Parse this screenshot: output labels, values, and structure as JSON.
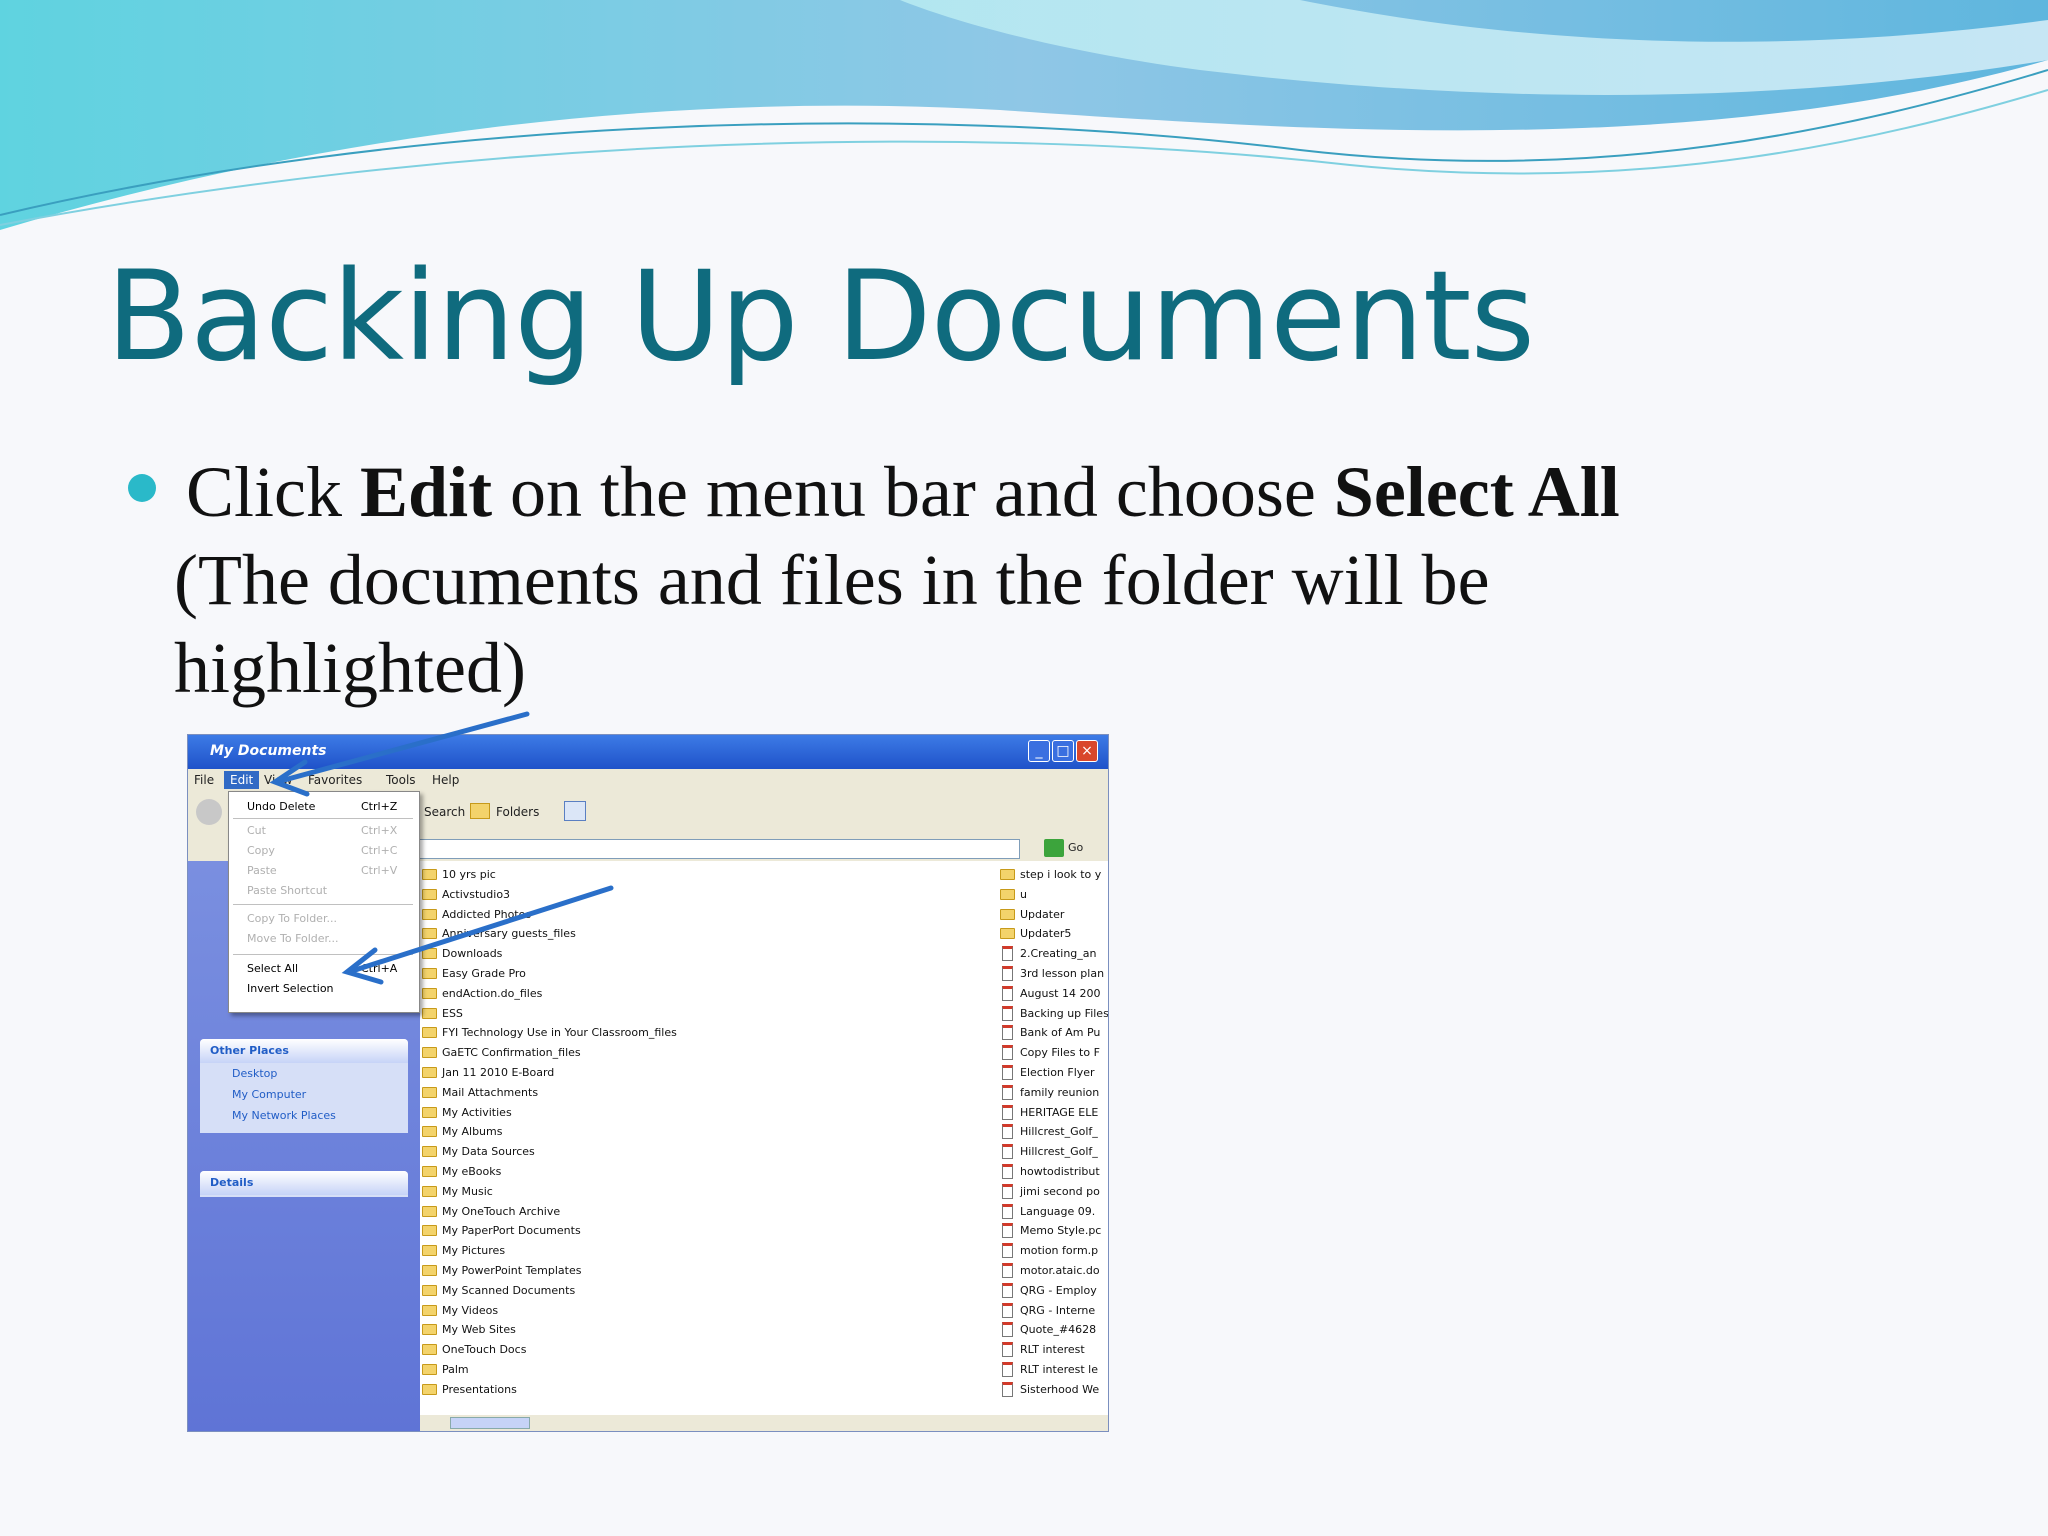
{
  "slide": {
    "title": "Backing Up Documents",
    "bullet": {
      "p1": "Click ",
      "b1": "Edit",
      "p2": " on the menu bar and choose ",
      "b2": "Select All",
      "line2": "(The documents and files in the folder will be",
      "line3": "highlighted)"
    }
  },
  "colors": {
    "title": "#0f6b7e",
    "bullet": "#2ab9c9",
    "arrow": "#2a6fc9"
  },
  "window": {
    "title": "My Documents",
    "menu": [
      "File",
      "Edit",
      "View",
      "Favorites",
      "Tools",
      "Help"
    ],
    "toolbar": {
      "search": "Search",
      "folders": "Folders"
    },
    "go": "Go",
    "edit_menu": [
      {
        "label": "Undo Delete",
        "shortcut": "Ctrl+Z",
        "disabled": false
      },
      {
        "label": "Cut",
        "shortcut": "Ctrl+X",
        "disabled": true
      },
      {
        "label": "Copy",
        "shortcut": "Ctrl+C",
        "disabled": true
      },
      {
        "label": "Paste",
        "shortcut": "Ctrl+V",
        "disabled": true
      },
      {
        "label": "Paste Shortcut",
        "shortcut": "",
        "disabled": true
      },
      {
        "label": "Copy To Folder...",
        "shortcut": "",
        "disabled": true
      },
      {
        "label": "Move To Folder...",
        "shortcut": "",
        "disabled": true
      },
      {
        "label": "Select All",
        "shortcut": "Ctrl+A",
        "disabled": false
      },
      {
        "label": "Invert Selection",
        "shortcut": "",
        "disabled": false
      }
    ],
    "tasks": {
      "other_places": "Other Places",
      "places": [
        "Desktop",
        "My Computer",
        "My Network Places"
      ],
      "details": "Details"
    },
    "files_col1": [
      "10 yrs pic",
      "Activstudio3",
      "Addicted Photos",
      "Anniversary guests_files",
      "Downloads",
      "Easy Grade Pro",
      "endAction.do_files",
      "ESS",
      "FYI Technology Use in Your Classroom_files",
      "GaETC Confirmation_files",
      "Jan 11 2010 E-Board",
      "Mail Attachments",
      "My Activities",
      "My Albums",
      "My Data Sources",
      "My eBooks",
      "My Music",
      "My OneTouch Archive",
      "My PaperPort Documents",
      "My Pictures",
      "My PowerPoint Templates",
      "My Scanned Documents",
      "My Videos",
      "My Web Sites",
      "OneTouch Docs",
      "Palm",
      "Presentations"
    ],
    "files_col2": [
      {
        "name": "step i look to y",
        "kind": "folder"
      },
      {
        "name": "u",
        "kind": "folder"
      },
      {
        "name": "Updater",
        "kind": "folder"
      },
      {
        "name": "Updater5",
        "kind": "folder"
      },
      {
        "name": "2.Creating_an",
        "kind": "doc"
      },
      {
        "name": "3rd lesson plan",
        "kind": "doc"
      },
      {
        "name": "August 14 200",
        "kind": "doc"
      },
      {
        "name": "Backing up Files",
        "kind": "doc"
      },
      {
        "name": "Bank of Am Pu",
        "kind": "doc"
      },
      {
        "name": "Copy Files to F",
        "kind": "doc"
      },
      {
        "name": "Election Flyer",
        "kind": "doc"
      },
      {
        "name": "family reunion",
        "kind": "doc"
      },
      {
        "name": "HERITAGE ELE",
        "kind": "doc"
      },
      {
        "name": "Hillcrest_Golf_",
        "kind": "doc"
      },
      {
        "name": "Hillcrest_Golf_",
        "kind": "doc"
      },
      {
        "name": "howtodistribut",
        "kind": "doc"
      },
      {
        "name": "jimi second po",
        "kind": "doc"
      },
      {
        "name": "Language 09.",
        "kind": "doc"
      },
      {
        "name": "Memo Style.pc",
        "kind": "doc"
      },
      {
        "name": "motion form.p",
        "kind": "doc"
      },
      {
        "name": "motor.ataic.do",
        "kind": "doc"
      },
      {
        "name": "QRG - Employ",
        "kind": "doc"
      },
      {
        "name": "QRG - Interne",
        "kind": "doc"
      },
      {
        "name": "Quote_#4628",
        "kind": "doc"
      },
      {
        "name": "RLT interest",
        "kind": "doc"
      },
      {
        "name": "RLT interest le",
        "kind": "doc"
      },
      {
        "name": "Sisterhood We",
        "kind": "doc"
      }
    ]
  }
}
